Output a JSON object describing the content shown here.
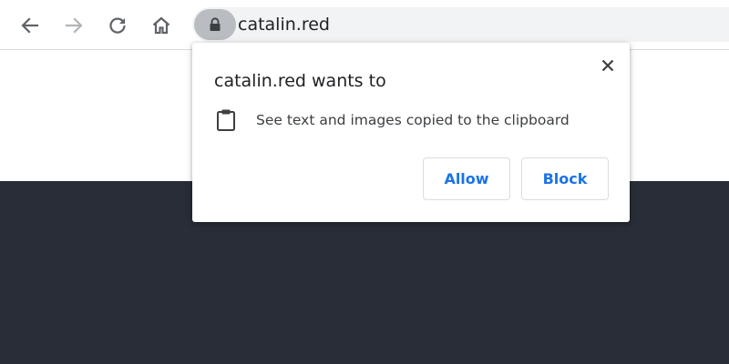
{
  "browser": {
    "url": "catalin.red"
  },
  "permission_prompt": {
    "title": "catalin.red wants to",
    "permission_text": "See text and images copied to the clipboard",
    "allow_label": "Allow",
    "block_label": "Block",
    "icons": {
      "close": "close-icon",
      "permission": "clipboard-icon"
    }
  },
  "colors": {
    "accent": "#1a73e8",
    "page_dark": "#282d37",
    "omnibox_bg": "#f1f3f4",
    "lock_pill": "#b9bcc0"
  }
}
